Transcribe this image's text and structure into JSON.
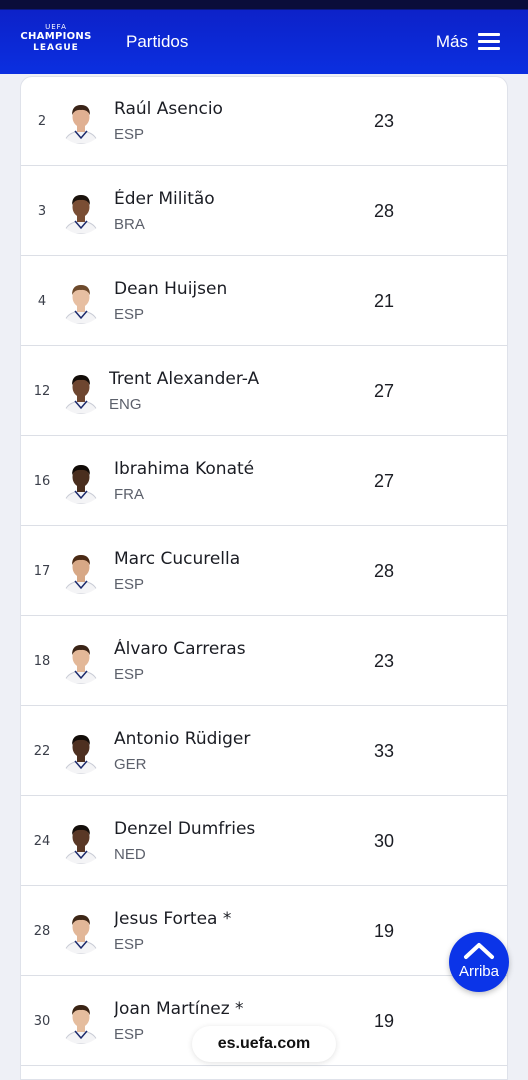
{
  "header": {
    "logo_top": "UEFA",
    "logo_line1": "CHAMPIONS",
    "logo_line2": "LEAGUE",
    "nav_matches": "Partidos",
    "more_label": "Más"
  },
  "players": [
    {
      "number": "2",
      "name": "Raúl Asencio",
      "nationality": "ESP",
      "age": "23",
      "skin": "#e0b092",
      "hair": "#3a2418"
    },
    {
      "number": "3",
      "name": "Éder Militão",
      "nationality": "BRA",
      "age": "28",
      "skin": "#7a4e34",
      "hair": "#1a120c"
    },
    {
      "number": "4",
      "name": "Dean Huijsen",
      "nationality": "ESP",
      "age": "21",
      "skin": "#e7bfa2",
      "hair": "#6d4a2c"
    },
    {
      "number": "12",
      "name": "Trent Alexander-A",
      "nationality": "ENG",
      "age": "27",
      "skin": "#6e4630",
      "hair": "#120c08"
    },
    {
      "number": "16",
      "name": "Ibrahima Konaté",
      "nationality": "FRA",
      "age": "27",
      "skin": "#4a2e1e",
      "hair": "#100a06"
    },
    {
      "number": "17",
      "name": "Marc Cucurella",
      "nationality": "ESP",
      "age": "28",
      "skin": "#d7a886",
      "hair": "#4a2a14"
    },
    {
      "number": "18",
      "name": "Álvaro Carreras",
      "nationality": "ESP",
      "age": "23",
      "skin": "#e3b898",
      "hair": "#3a2416"
    },
    {
      "number": "22",
      "name": "Antonio Rüdiger",
      "nationality": "GER",
      "age": "33",
      "skin": "#4e3020",
      "hair": "#120c08"
    },
    {
      "number": "24",
      "name": "Denzel Dumfries",
      "nationality": "NED",
      "age": "30",
      "skin": "#5a3826",
      "hair": "#140e0a"
    },
    {
      "number": "28",
      "name": "Jesus Fortea *",
      "nationality": "ESP",
      "age": "19",
      "skin": "#e2b798",
      "hair": "#3d2616"
    },
    {
      "number": "30",
      "name": "Joan Martínez *",
      "nationality": "ESP",
      "age": "19",
      "skin": "#e5bd9e",
      "hair": "#3a2414"
    }
  ],
  "colors": {
    "brand_blue": "#0b2fe0",
    "header_dark": "#0a0d3a"
  },
  "icons": {
    "menu": "hamburger-icon",
    "back_to_top": "chevron-up-icon"
  },
  "back_to_top_label": "Arriba",
  "url_label": "es.uefa.com"
}
